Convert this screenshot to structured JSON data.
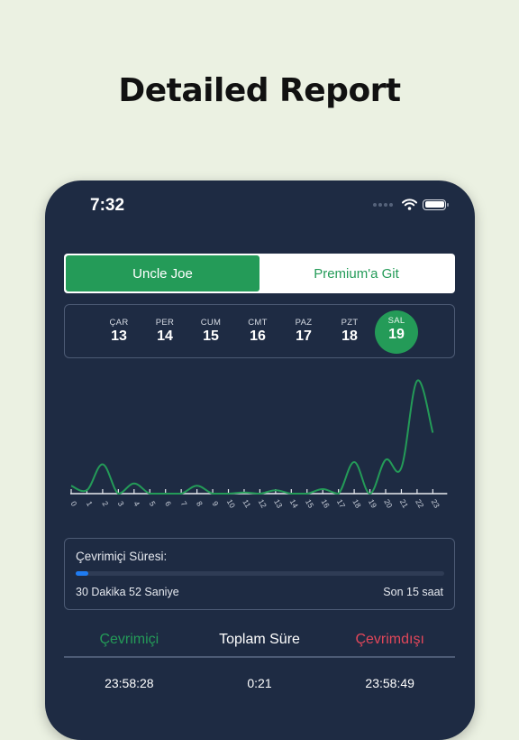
{
  "headline": "Detailed Report",
  "status_bar": {
    "time": "7:32",
    "icons": [
      "signal-dots-icon",
      "wifi-icon",
      "battery-icon"
    ]
  },
  "segment": {
    "options": [
      {
        "label": "Uncle Joe",
        "active": true
      },
      {
        "label": "Premium'a Git",
        "active": false
      }
    ]
  },
  "days": [
    {
      "name": "ÇAR",
      "date": "13",
      "active": false
    },
    {
      "name": "PER",
      "date": "14",
      "active": false
    },
    {
      "name": "CUM",
      "date": "15",
      "active": false
    },
    {
      "name": "CMT",
      "date": "16",
      "active": false
    },
    {
      "name": "PAZ",
      "date": "17",
      "active": false
    },
    {
      "name": "PZT",
      "date": "18",
      "active": false
    },
    {
      "name": "SAL",
      "date": "19",
      "active": true
    }
  ],
  "colors": {
    "accent_green": "#249b58",
    "offline_red": "#e2475a",
    "progress_blue": "#1f7cf2",
    "panel_bg": "#1e2b43",
    "page_bg": "#ebf1e2"
  },
  "chart_data": {
    "type": "line",
    "title": "",
    "xlabel": "",
    "ylabel": "",
    "x": [
      0,
      1,
      2,
      3,
      4,
      5,
      6,
      7,
      8,
      9,
      10,
      11,
      12,
      13,
      14,
      15,
      16,
      17,
      18,
      19,
      20,
      21,
      22,
      23
    ],
    "x_tick_labels": [
      "0",
      "1",
      "2",
      "3",
      "4",
      "5",
      "6",
      "7",
      "8",
      "9",
      "10",
      "11",
      "12",
      "13",
      "14",
      "15",
      "16",
      "17",
      "18",
      "19",
      "20",
      "21",
      "22",
      "23"
    ],
    "series": [
      {
        "name": "online",
        "color": "#249b58",
        "values": [
          0.07,
          0.03,
          0.26,
          0,
          0.09,
          0,
          0,
          0,
          0.07,
          0,
          0,
          0.01,
          0,
          0.03,
          0,
          0,
          0.04,
          0,
          0.28,
          0,
          0.3,
          0.23,
          1.0,
          0.54
        ]
      }
    ],
    "ylim": [
      0,
      1
    ],
    "grid": false,
    "legend": "none"
  },
  "online_time": {
    "label": "Çevrimiçi Süresi:",
    "value": "30 Dakika 52 Saniye",
    "range": "Son 15 saat",
    "progress_percent": 3.5
  },
  "stats": {
    "headers": {
      "online": "Çevrimiçi",
      "total": "Toplam Süre",
      "offline": "Çevrimdışı"
    },
    "values": {
      "online": "23:58:28",
      "total": "0:21",
      "offline": "23:58:49"
    }
  }
}
